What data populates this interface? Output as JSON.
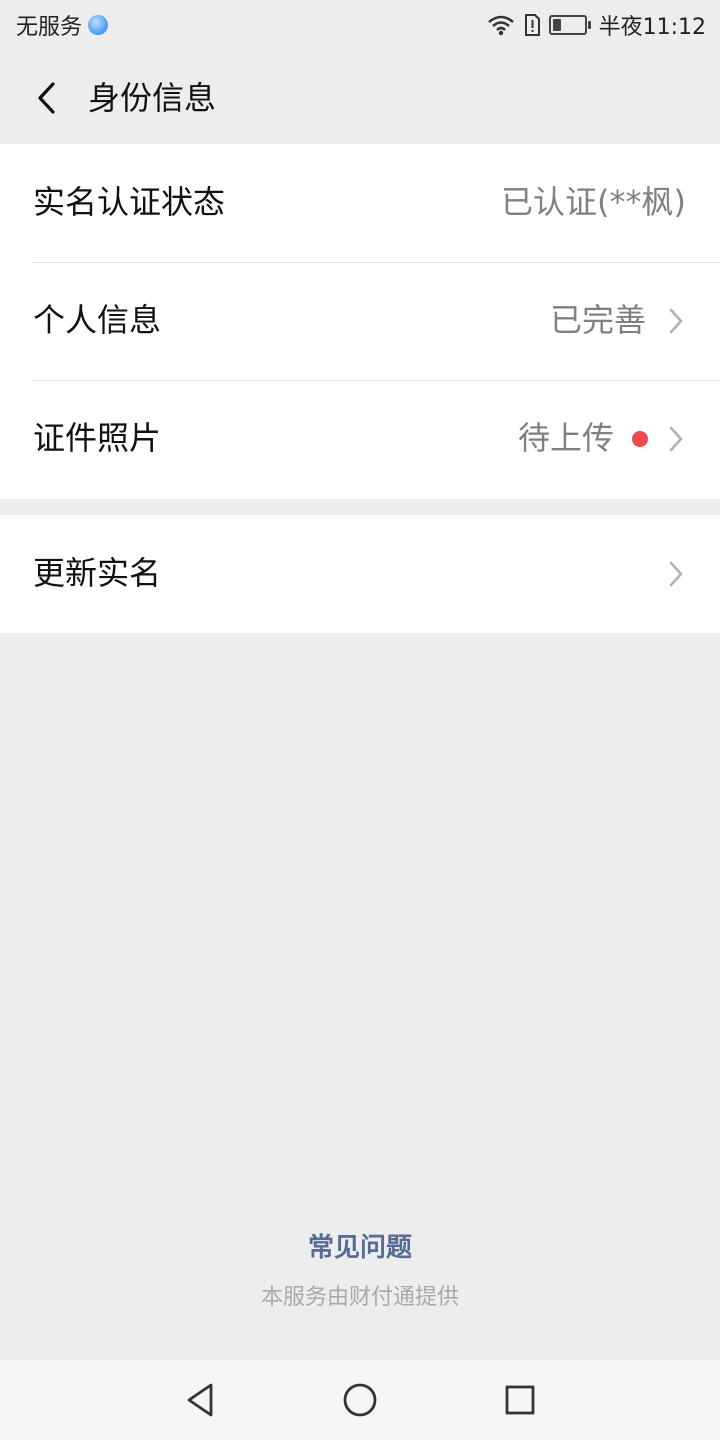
{
  "status_bar": {
    "carrier": "无服务",
    "time": "半夜11:12",
    "battery_level": 0.25
  },
  "header": {
    "title": "身份信息"
  },
  "rows": [
    {
      "label": "实名认证状态",
      "value": "已认证(**枫)"
    },
    {
      "label": "个人信息",
      "value": "已完善"
    },
    {
      "label": "证件照片",
      "value": "待上传"
    },
    {
      "label": "更新实名",
      "value": ""
    }
  ],
  "footer": {
    "faq": "常见问题",
    "provider": "本服务由财付通提供"
  },
  "colors": {
    "background": "#ededed",
    "card": "#ffffff",
    "link": "#576b95",
    "badge": "#f0484f",
    "muted": "#808080"
  },
  "icons": {
    "back": "chevron-left-icon",
    "row_arrow": "chevron-right-icon",
    "nav_back": "triangle-back-icon",
    "nav_home": "circle-home-icon",
    "nav_recent": "square-recents-icon"
  }
}
